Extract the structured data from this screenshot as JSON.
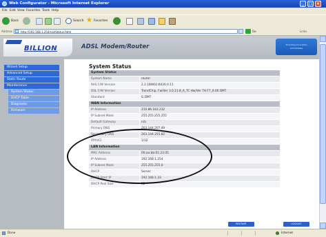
{
  "window": {
    "title": "Web Configurator - Microsoft Internet Explorer"
  },
  "menu": [
    "File",
    "Edit",
    "View",
    "Favorites",
    "Tools",
    "Help"
  ],
  "toolbar": {
    "back_label": "Back",
    "search_label": "Search",
    "favorites_label": "Favorites"
  },
  "address": {
    "label": "Address",
    "url": "http://192.168.1.254/cgi/Status.html",
    "go_label": "Go",
    "links_label": "Links"
  },
  "header": {
    "logo_text": "BILLION",
    "title": "ADSL Modem/Router",
    "badge_line1": "Providing Innovative",
    "badge_line2": "and Reliable"
  },
  "sidebar": {
    "items": [
      {
        "label": "Wizard Setup",
        "level": "top"
      },
      {
        "label": "Advanced Setup",
        "level": "top"
      },
      {
        "label": "Static Route",
        "level": "top"
      },
      {
        "label": "Maintenance",
        "level": "top"
      },
      {
        "label": "System Status",
        "level": "sub"
      },
      {
        "label": "DHCP Table",
        "level": "sub"
      },
      {
        "label": "Diagnostic",
        "level": "sub"
      },
      {
        "label": "Firmware",
        "level": "sub"
      }
    ]
  },
  "status": {
    "page_title": "System Status",
    "system_heading": "System Status",
    "system_rows": [
      {
        "label": "System Name",
        "value": "router"
      },
      {
        "label": "RAS F/W Version",
        "value": "2.2.1BW02.6020.0.11"
      },
      {
        "label": "DSL F/W Version",
        "value": "TrendChip, Fw/Ver 3.0.11.8_A_TC Hw/Ver TH.F7_0.00 DMT"
      },
      {
        "label": "Standard",
        "value": "G.DMT"
      }
    ],
    "wan_heading": "WAN Information",
    "wan_rows": [
      {
        "label": "IP Address",
        "value": "210.86.183.232"
      },
      {
        "label": "IP Subnet Mask",
        "value": "255.255.255.255"
      },
      {
        "label": "Default Gateway",
        "value": "n/a"
      },
      {
        "label": "Primary DNS",
        "value": "203.144.207.49"
      },
      {
        "label": "Secondary DNS",
        "value": "203.144.255.82"
      },
      {
        "label": "VPI/VCI",
        "value": "1/32"
      }
    ],
    "lan_heading": "LAN Information",
    "lan_rows": [
      {
        "label": "MAC Address",
        "value": "00:aa:bb:01:23:45"
      },
      {
        "label": "IP Address",
        "value": "192.168.1.254"
      },
      {
        "label": "IP Subnet Mask",
        "value": "255.255.255.0"
      },
      {
        "label": "DHCP",
        "value": "Server"
      },
      {
        "label": "DHCP Start IP",
        "value": "192.168.1.33"
      },
      {
        "label": "DHCP Pool Size",
        "value": "32"
      }
    ],
    "restart_label": "RESTART",
    "logout_label": "LOGOUT"
  },
  "statusbar": {
    "left_text": "Done",
    "zone_text": "Internet"
  },
  "colors": {
    "nav_top": "#2d6ad8",
    "nav_sub": "#6e9be8",
    "title_bar": "#1f4fc9",
    "section_head": "#b9bec6"
  }
}
